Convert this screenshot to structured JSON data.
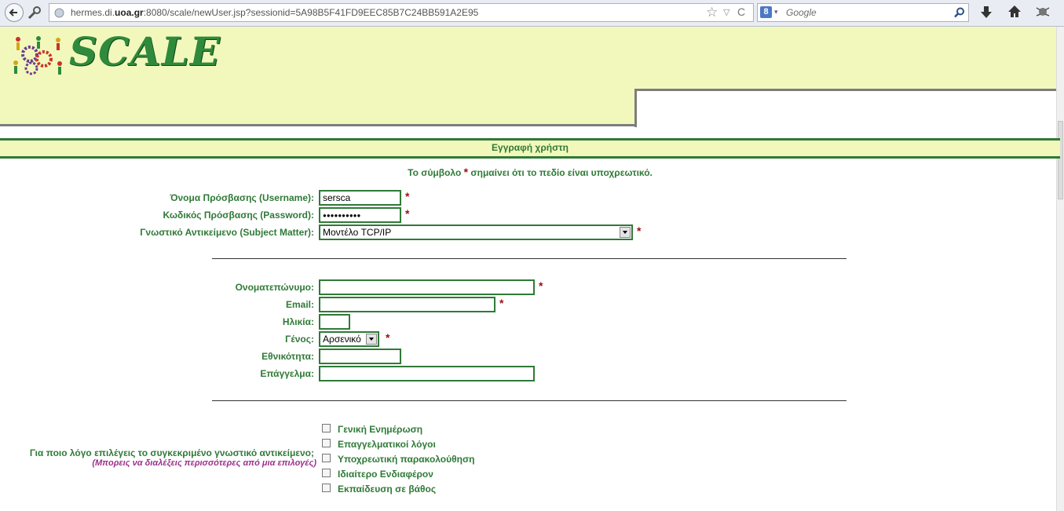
{
  "browser": {
    "url_pre": "hermes.di.",
    "url_domain": "uoa.gr",
    "url_post": ":8080/scale/newUser.jsp?sessionid=5A98B5F41FD9EEC85B7C24BB591A2E95",
    "search_placeholder": "Google",
    "search_engine_letter": "8"
  },
  "header": {
    "logo_text": "SCALE"
  },
  "page_title": "Εγγραφή χρήστη",
  "required_note": {
    "before": "Το σύμβολο",
    "star": "*",
    "after": "σημαίνει ότι το πεδίο είναι υποχρεωτικό."
  },
  "account": {
    "username_label": "Όνομα Πρόσβασης (Username):",
    "username_value": "sersca",
    "password_label": "Κωδικός Πρόσβασης (Password):",
    "password_value": "●●●●●●●●●●",
    "subject_label": "Γνωστικό Αντικείμενο (Subject Matter):",
    "subject_value": "Μοντέλο TCP/IP"
  },
  "personal": {
    "fullname_label": "Ονοματεπώνυμο:",
    "fullname_value": "",
    "email_label": "Email:",
    "email_value": "",
    "age_label": "Ηλικία:",
    "age_value": "",
    "gender_label": "Γένος:",
    "gender_value": "Αρσενικό",
    "nationality_label": "Εθνικότητα:",
    "nationality_value": "",
    "profession_label": "Επάγγελμα:",
    "profession_value": ""
  },
  "reason": {
    "question": "Για ποιο λόγο επιλέγεις το συγκεκριμένο γνωστικό αντικείμενο;",
    "hint": "(Μπορεις να διαλέξεις περισσότερες από μια επιλογές)",
    "options": [
      "Γενική Ενημέρωση",
      "Επαγγελματικοί λόγοι",
      "Υποχρεωτική παρακολούθηση",
      "Ιδιαίτερο Ενδιαφέρον",
      "Εκπαίδευση σε βάθος"
    ]
  },
  "colors": {
    "green": "#2f7a37",
    "header_bg": "#f2f8bb",
    "required_red": "#9a0f0f",
    "hint_purple": "#9b2f8c"
  }
}
